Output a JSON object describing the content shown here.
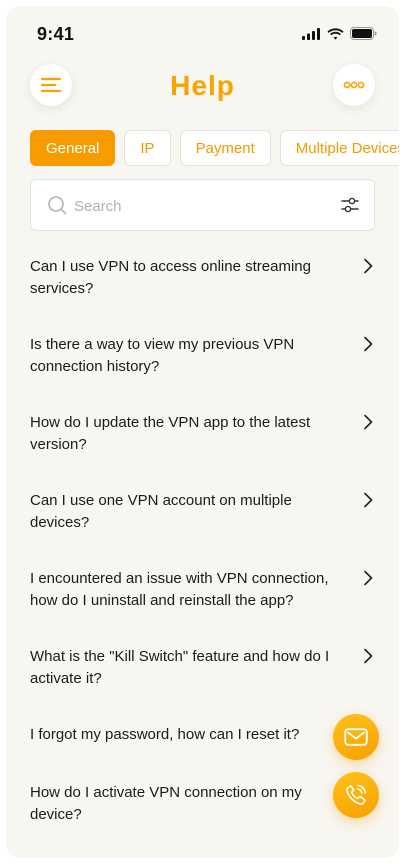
{
  "status_bar": {
    "time": "9:41"
  },
  "header": {
    "title": "Help"
  },
  "tabs": [
    {
      "label": "General",
      "active": true
    },
    {
      "label": "IP",
      "active": false
    },
    {
      "label": "Payment",
      "active": false
    },
    {
      "label": "Multiple Devices",
      "active": false
    }
  ],
  "search": {
    "placeholder": "Search",
    "value": ""
  },
  "faq": [
    {
      "question": "Can I use VPN to access online streaming services?"
    },
    {
      "question": "Is there a way to view my previous VPN connection history?"
    },
    {
      "question": "How do I update the VPN app to the latest version?"
    },
    {
      "question": "Can I use one VPN account on multiple devices?"
    },
    {
      "question": "I encountered an issue with VPN connection, how do I uninstall and reinstall the app?"
    },
    {
      "question": "What is the \"Kill Switch\" feature and how do I activate it?"
    },
    {
      "question": "I forgot my password, how can I reset it?"
    },
    {
      "question": "How do I activate VPN connection on my device?"
    }
  ],
  "icons": {
    "menu": "menu-icon",
    "more": "more-icon",
    "search": "search-icon",
    "filter": "filter-icon",
    "chevron": "chevron-right-icon",
    "mail": "mail-icon",
    "phone": "phone-icon"
  },
  "colors": {
    "accent": "#f79b00",
    "title": "#f7a400",
    "background": "#f8f6f1"
  }
}
